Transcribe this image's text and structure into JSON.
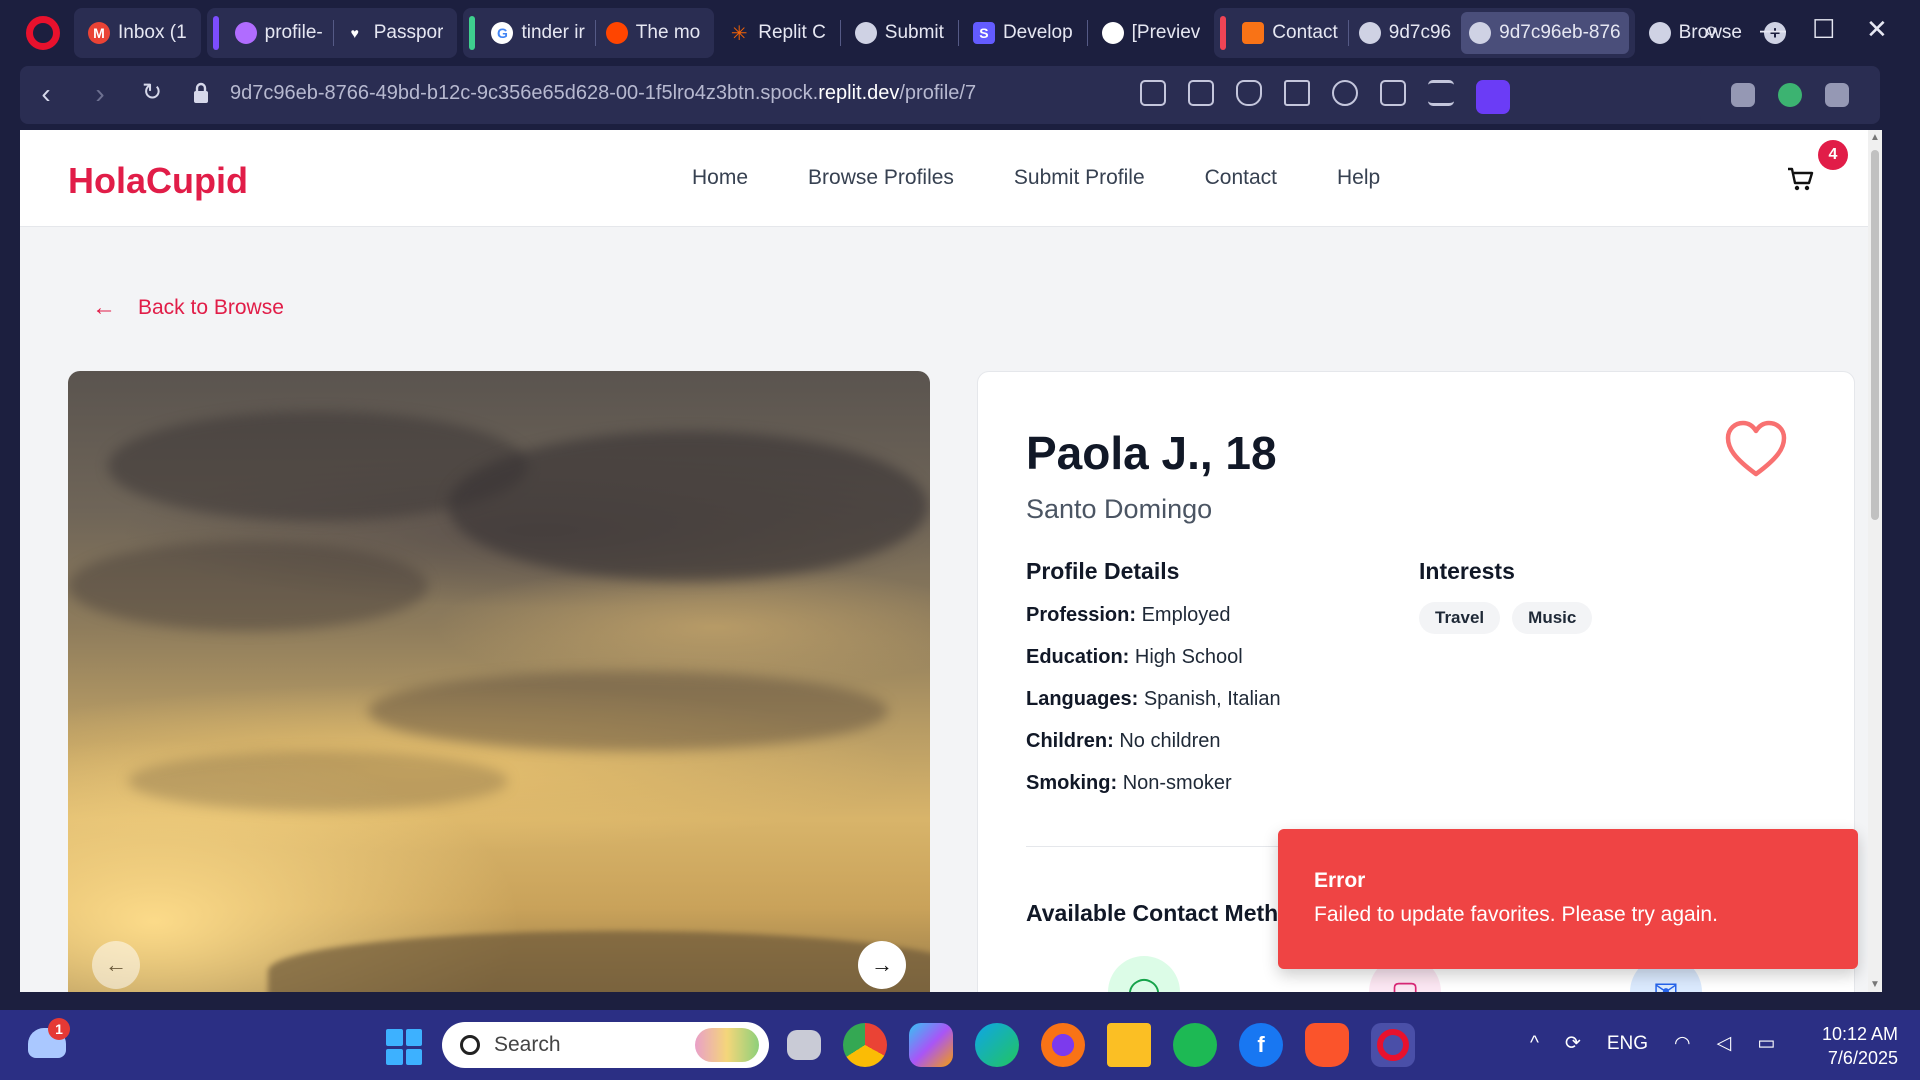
{
  "browser": {
    "tabs": [
      {
        "title": "Inbox (1",
        "color": "#ea4335"
      },
      {
        "title": "profile-",
        "color": "#b06cff"
      },
      {
        "title": "Passpor",
        "color": "#ffffff"
      },
      {
        "title": "tinder ir",
        "color": "#4285f4"
      },
      {
        "title": "The mo",
        "color": "#ff4500"
      },
      {
        "title": "Replit C",
        "color": "#f26207"
      },
      {
        "title": "Submit",
        "color": "#cfd2e4"
      },
      {
        "title": "Develop",
        "color": "#635bff"
      },
      {
        "title": "[Previev",
        "color": "#ffffff"
      },
      {
        "title": "Contact",
        "color": "#f97316"
      },
      {
        "title": "9d7c96",
        "color": "#cfd2e4"
      },
      {
        "title": "9d7c96eb-876",
        "color": "#cfd2e4"
      },
      {
        "title": "Browse",
        "color": "#cfd2e4"
      }
    ],
    "url_prefix": "9d7c96eb-8766-49bd-b12c-9c356e65d628-00-1f5lro4z3btn.spock.",
    "url_domain": "replit.dev",
    "url_path": "/profile/7",
    "new_tab": "+"
  },
  "site": {
    "logo": "HolaCupid",
    "nav": [
      "Home",
      "Browse Profiles",
      "Submit Profile",
      "Contact",
      "Help"
    ],
    "cart_count": "4"
  },
  "page": {
    "back_label": "Back to Browse",
    "name": "Paola J., 18",
    "city": "Santo Domingo",
    "details_title": "Profile Details",
    "details": [
      {
        "label": "Profession:",
        "value": "Employed"
      },
      {
        "label": "Education:",
        "value": "High School"
      },
      {
        "label": "Languages:",
        "value": "Spanish, Italian"
      },
      {
        "label": "Children:",
        "value": "No children"
      },
      {
        "label": "Smoking:",
        "value": "Non-smoker"
      }
    ],
    "interests_title": "Interests",
    "interests": [
      "Travel",
      "Music"
    ],
    "contact_title": "Available Contact Meth"
  },
  "toast": {
    "title": "Error",
    "message": "Failed to update favorites. Please try again."
  },
  "taskbar": {
    "weather_badge": "1",
    "search_label": "Search",
    "lang": "ENG",
    "time": "10:12 AM",
    "date": "7/6/2025"
  },
  "colors": {
    "brand": "#e11d48",
    "toast_bg": "#ef4444",
    "chrome_bg": "#1c1f3f"
  }
}
